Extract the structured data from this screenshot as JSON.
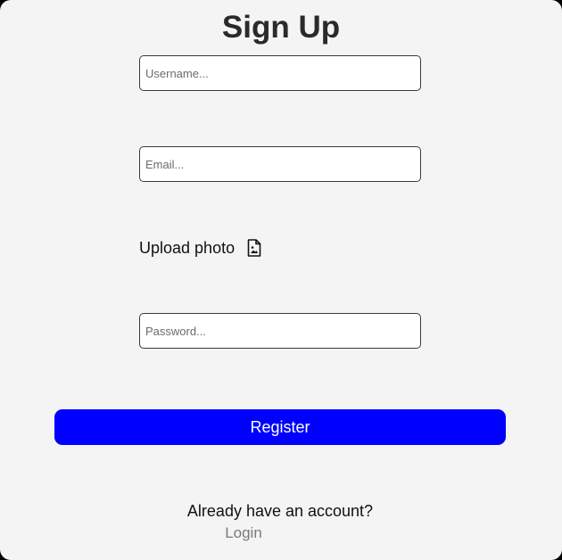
{
  "form": {
    "title": "Sign Up",
    "username_placeholder": "Username...",
    "email_placeholder": "Email...",
    "upload_label": "Upload photo",
    "upload_icon": "file-image-icon",
    "password_placeholder": "Password...",
    "register_label": "Register"
  },
  "footer": {
    "prompt": "Already have an account?",
    "login_label": "Login"
  },
  "colors": {
    "card_background": "#f4f4f4",
    "register_button": "#0000ff",
    "login_link": "#7a7a7a"
  }
}
